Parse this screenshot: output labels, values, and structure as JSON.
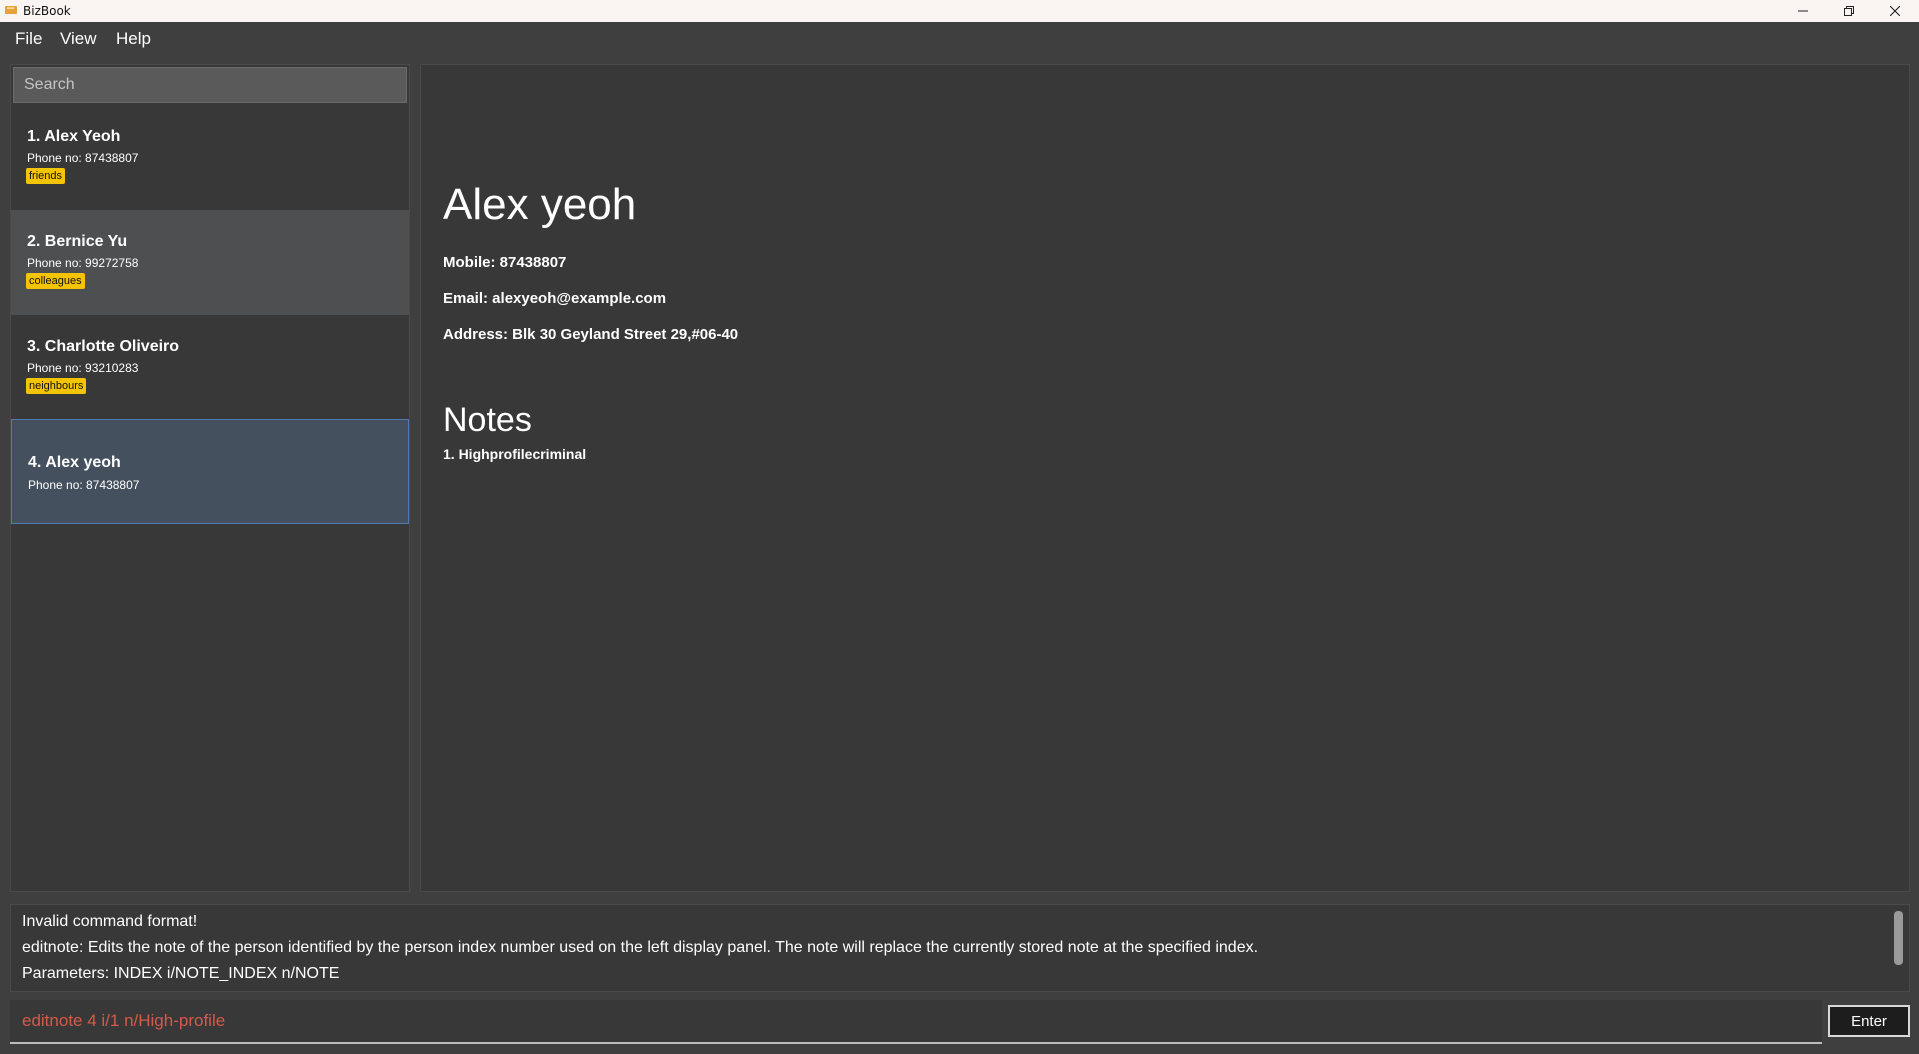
{
  "window": {
    "title": "BizBook",
    "icons": {
      "app": "notebook-icon",
      "minimize": "minimize-icon",
      "maximize": "restore-icon",
      "close": "close-icon"
    }
  },
  "menu": {
    "file": "File",
    "view": "View",
    "help": "Help"
  },
  "search": {
    "placeholder": "Search"
  },
  "persons": [
    {
      "index_name": "1. Alex Yeoh",
      "phone": "Phone no: 87438807",
      "tag": "friends"
    },
    {
      "index_name": "2. Bernice Yu",
      "phone": "Phone no: 99272758",
      "tag": "colleagues"
    },
    {
      "index_name": "3. Charlotte Oliveiro",
      "phone": "Phone no: 93210283",
      "tag": "neighbours"
    },
    {
      "index_name": "4. Alex yeoh",
      "phone": "Phone no: 87438807"
    }
  ],
  "detail": {
    "name": "Alex yeoh",
    "mobile": "Mobile: 87438807",
    "email": "Email: alexyeoh@example.com",
    "address": "Address: Blk 30 Geyland Street 29,#06-40",
    "notes_heading": "Notes",
    "notes": [
      "1. Highprofilecriminal"
    ]
  },
  "result": {
    "line1": "Invalid command format!",
    "line2": "editnote: Edits the note of the person identified by the person index number used on the left display panel. The note will replace the currently stored note at the specified index.",
    "line3": "Parameters: INDEX i/NOTE_INDEX n/NOTE"
  },
  "command": {
    "value": "editnote 4 i/1 n/High-profile",
    "enter_label": "Enter"
  },
  "colors": {
    "tag": "#f5c400",
    "command_error_text": "#d45a4a",
    "card_highlight": "#4d4f50",
    "card_selected": "#44505e",
    "card_selected_border": "#4f7ab4"
  }
}
